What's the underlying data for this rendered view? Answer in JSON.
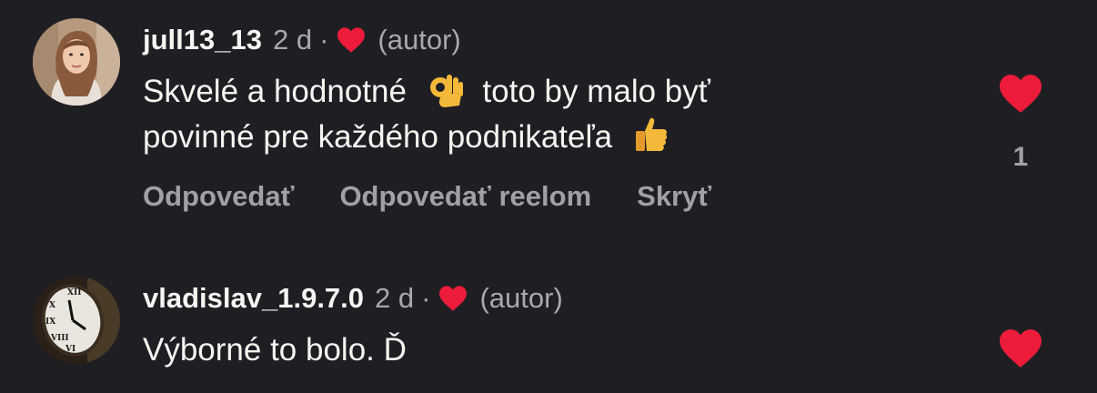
{
  "colors": {
    "background": "#1f1f23",
    "heart": "#ed1c3b",
    "muted": "#a0a0a6"
  },
  "comments": [
    {
      "username": "jull13_13",
      "time": "2 d",
      "separator": "·",
      "author_tag": "(autor)",
      "line1_a": "Skvelé a hodnotné",
      "line1_b": "toto by malo byť",
      "line2": "povinné pre každého podnikateľa",
      "emoji1": "ok-hand-icon",
      "emoji2": "thumbs-up-icon",
      "like_count": "1",
      "actions": {
        "reply": "Odpovedať",
        "reply_reel": "Odpovedať reelom",
        "hide": "Skryť"
      }
    },
    {
      "username": "vladislav_1.9.7.0",
      "time": "2 d",
      "separator": "·",
      "author_tag": "(autor)",
      "text": "Výborné to bolo. Ď"
    }
  ]
}
